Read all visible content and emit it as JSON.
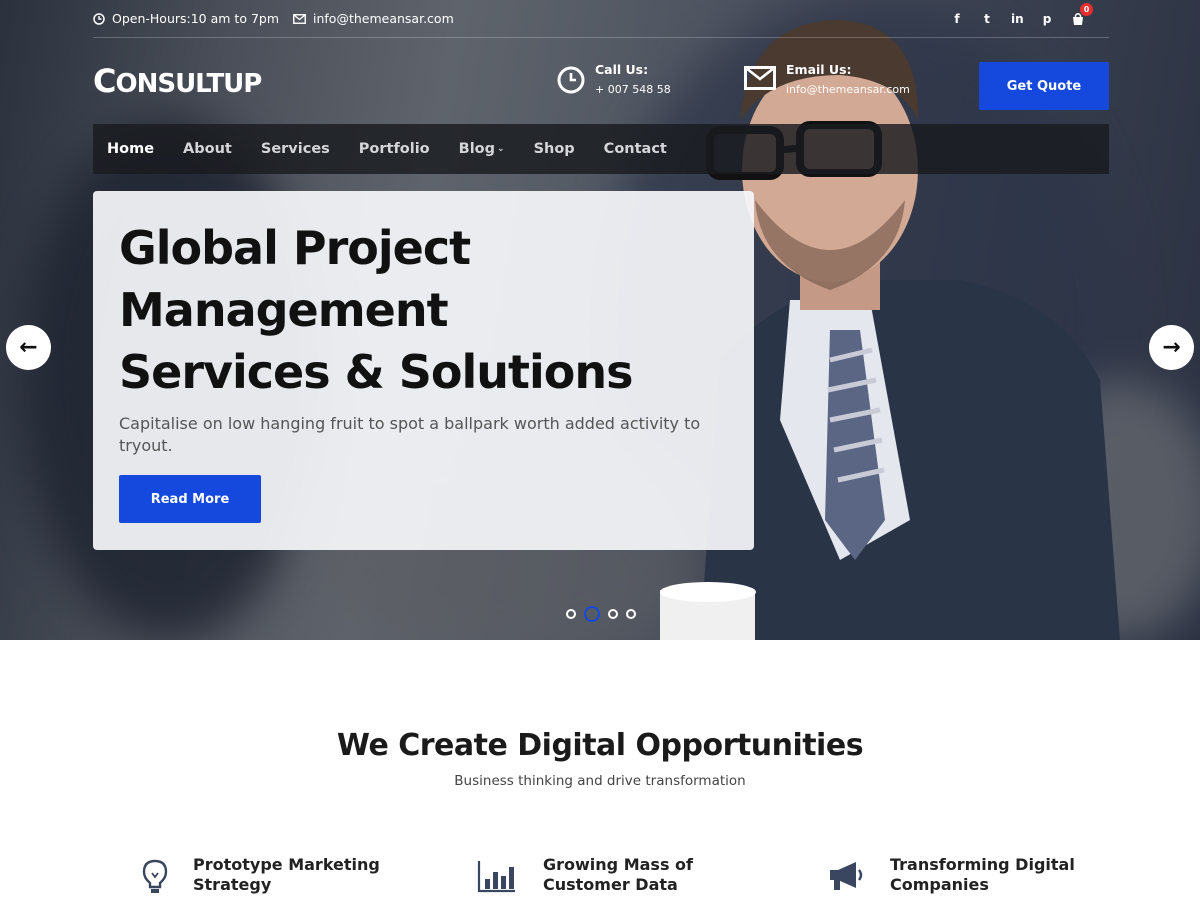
{
  "topbar": {
    "hours": "Open-Hours:10 am to 7pm",
    "email": "info@themeansar.com",
    "socials": [
      "f",
      "t",
      "in",
      "p"
    ],
    "cart_count": "0"
  },
  "header": {
    "logo_first": "C",
    "logo_rest": "ONSULTUP",
    "call_label": "Call Us:",
    "call_value": "+ 007 548 58",
    "email_label": "Email Us:",
    "email_value": "info@themeansar.com",
    "quote_label": "Get Quote"
  },
  "nav": {
    "items": [
      "Home",
      "About",
      "Services",
      "Portfolio",
      "Blog",
      "Shop",
      "Contact"
    ],
    "active": "Home"
  },
  "slider": {
    "title_line1": "Global Project",
    "title_line2": "Management",
    "title_line3": "Services & Solutions",
    "subtitle": "Capitalise on low hanging fruit to spot a ballpark worth added activity to tryout.",
    "button": "Read More",
    "prev": "←",
    "next": "→",
    "dots": 4,
    "active_dot": 2
  },
  "section": {
    "title": "We Create Digital Opportunities",
    "subtitle": "Business thinking and drive transformation"
  },
  "features": [
    {
      "line1": "Prototype Marketing",
      "line2": "Strategy",
      "icon": "lightbulb-icon"
    },
    {
      "line1": "Growing Mass of",
      "line2": "Customer Data",
      "icon": "bar-chart-icon"
    },
    {
      "line1": "Transforming Digital",
      "line2": "Companies",
      "icon": "megaphone-icon"
    }
  ],
  "colors": {
    "accent": "#1549dd",
    "badge": "#e62e2e"
  }
}
